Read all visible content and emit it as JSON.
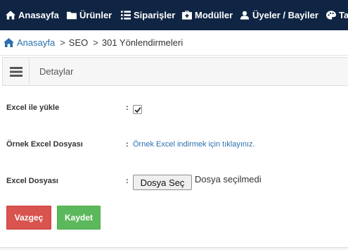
{
  "topnav": {
    "items": [
      {
        "label": "Anasayfa",
        "icon": "home-icon"
      },
      {
        "label": "Ürünler",
        "icon": "folder-icon"
      },
      {
        "label": "Siparişler",
        "icon": "list-icon"
      },
      {
        "label": "Modüller",
        "icon": "medkit-icon"
      },
      {
        "label": "Üyeler / Bayiler",
        "icon": "user-icon"
      },
      {
        "label": "Ta",
        "icon": "palette-icon"
      }
    ],
    "background": "#0f2543"
  },
  "breadcrumb": {
    "home": "Anasayfa",
    "separator": ">",
    "items": [
      "SEO",
      "301 Yönlendirmeleri"
    ]
  },
  "panel": {
    "title": "Detaylar"
  },
  "form": {
    "colon": ":",
    "excel_upload": {
      "label": "Excel ile yükle",
      "checked": true
    },
    "sample_file": {
      "label": "Örnek Excel Dosyası",
      "link_text": "Örnek Excel indirmek için tıklayınız."
    },
    "excel_file": {
      "label": "Excel Dosyası",
      "button_label": "Dosya Seç",
      "status": "Dosya seçilmedi"
    }
  },
  "actions": {
    "cancel_label": "Vazgeç",
    "save_label": "Kaydet",
    "cancel_color": "#d9534f",
    "save_color": "#5cb85c"
  }
}
